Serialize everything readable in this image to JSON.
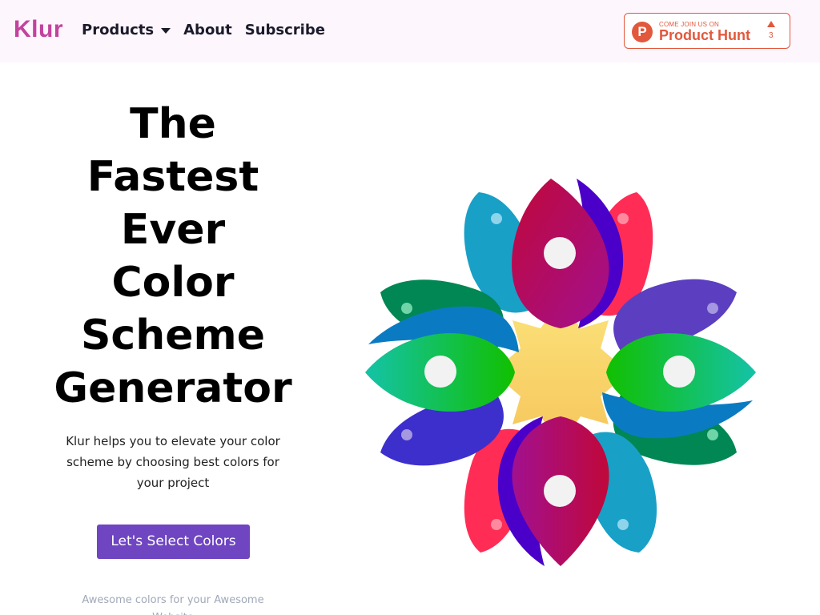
{
  "brand": {
    "name": "Klur",
    "color": "#c2439d"
  },
  "nav": {
    "items": [
      {
        "label": "Products",
        "has_dropdown": true
      },
      {
        "label": "About"
      },
      {
        "label": "Subscribe"
      }
    ]
  },
  "product_hunt": {
    "logo_letter": "P",
    "small_text": "COME JOIN US ON",
    "name": "Product Hunt",
    "upvotes": "3",
    "color": "#e2583c"
  },
  "hero": {
    "title_lines": [
      "The",
      "Fastest",
      "Ever",
      "Color",
      "Scheme",
      "Generator"
    ],
    "description": "Klur helps you to elevate your color scheme by choosing best colors for your project",
    "cta_label": "Let's Select Colors",
    "cta_color": "#6f45c2",
    "tagline": "Awesome colors for your Awesome Website"
  },
  "illustration": {
    "icon": "flower-icon",
    "colors": [
      "#18a0c7",
      "#ff2d55",
      "#4a00c8",
      "#c0083a",
      "#11c000",
      "#018754",
      "#5b3fc0",
      "#f8d36a"
    ]
  }
}
